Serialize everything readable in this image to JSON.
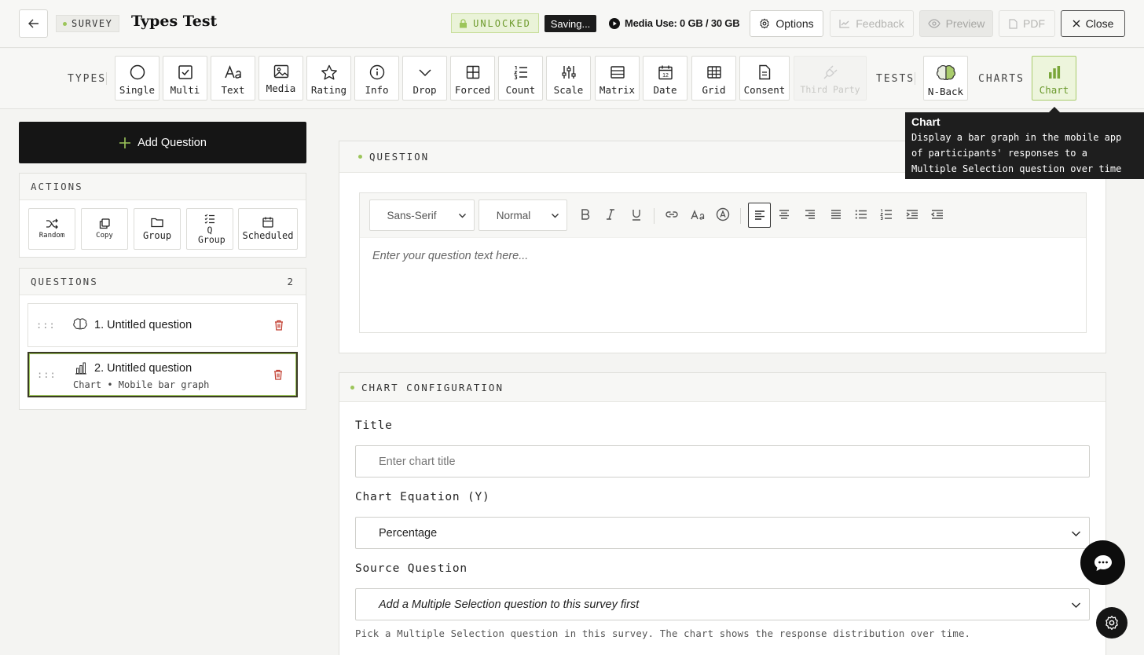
{
  "header": {
    "survey_tag": "SURVEY",
    "title": "Types Test",
    "unlocked": "UNLOCKED",
    "saving": "Saving...",
    "media_use": "Media Use: 0 GB / 30 GB",
    "options": "Options",
    "feedback": "Feedback",
    "preview": "Preview",
    "pdf": "PDF",
    "close": "Close"
  },
  "toolbar": {
    "types_label": "TYPES",
    "tests_label": "TESTS",
    "charts_label": "CHARTS",
    "types": [
      {
        "label": "Single",
        "icon": "circle-icon"
      },
      {
        "label": "Multi",
        "icon": "checkbox-icon"
      },
      {
        "label": "Text",
        "icon": "text-aa-icon"
      },
      {
        "label": "Media",
        "icon": "image-icon"
      },
      {
        "label": "Rating",
        "icon": "star-icon"
      },
      {
        "label": "Info",
        "icon": "info-icon"
      },
      {
        "label": "Drop",
        "icon": "chevron-down-icon"
      },
      {
        "label": "Forced",
        "icon": "grid-icon"
      },
      {
        "label": "Count",
        "icon": "numbered-list-icon"
      },
      {
        "label": "Scale",
        "icon": "sliders-icon"
      },
      {
        "label": "Matrix",
        "icon": "matrix-icon"
      },
      {
        "label": "Date",
        "icon": "calendar-icon"
      },
      {
        "label": "Grid",
        "icon": "table-icon"
      },
      {
        "label": "Consent",
        "icon": "document-icon"
      },
      {
        "label": "Third Party",
        "icon": "plug-icon"
      }
    ],
    "tests": [
      {
        "label": "N-Back",
        "icon": "brain-icon"
      }
    ],
    "charts": [
      {
        "label": "Chart",
        "icon": "bar-chart-icon"
      }
    ]
  },
  "tooltip": {
    "title": "Chart",
    "description": "Display a bar graph in the mobile app of participants' responses to a Multiple Selection question over time"
  },
  "sidebar": {
    "add_question": "Add Question",
    "actions_label": "ACTIONS",
    "actions": [
      {
        "label": "Random",
        "icon": "shuffle-icon"
      },
      {
        "label": "Copy",
        "icon": "copy-icon"
      },
      {
        "label": "Group",
        "icon": "folder-icon"
      },
      {
        "label": "Q Group",
        "icon": "checklist-icon"
      },
      {
        "label": "Scheduled",
        "icon": "calendar-icon"
      }
    ],
    "questions_label": "QUESTIONS",
    "questions_count": "2",
    "questions": [
      {
        "title": "1. Untitled question",
        "subtitle": "",
        "icon": "brain-icon"
      },
      {
        "title": "2. Untitled question",
        "subtitle": "Chart • Mobile bar graph",
        "icon": "bar-chart-icon"
      }
    ]
  },
  "question_card": {
    "heading": "QUESTION",
    "font_select": "Sans-Serif",
    "size_select": "Normal",
    "placeholder": "Enter your question text here..."
  },
  "chart_config": {
    "heading": "CHART CONFIGURATION",
    "title_label": "Title",
    "title_placeholder": "Enter chart title",
    "equation_label": "Chart Equation (Y)",
    "equation_value": "Percentage",
    "source_label": "Source Question",
    "source_value": "Add a Multiple Selection question to this survey first",
    "help": "Pick a Multiple Selection question in this survey. The chart shows the response distribution over time."
  },
  "colors": {
    "accent": "#9cc55a",
    "accent_text": "#6c9a2e",
    "dark": "#151515",
    "danger": "#c0392b"
  }
}
